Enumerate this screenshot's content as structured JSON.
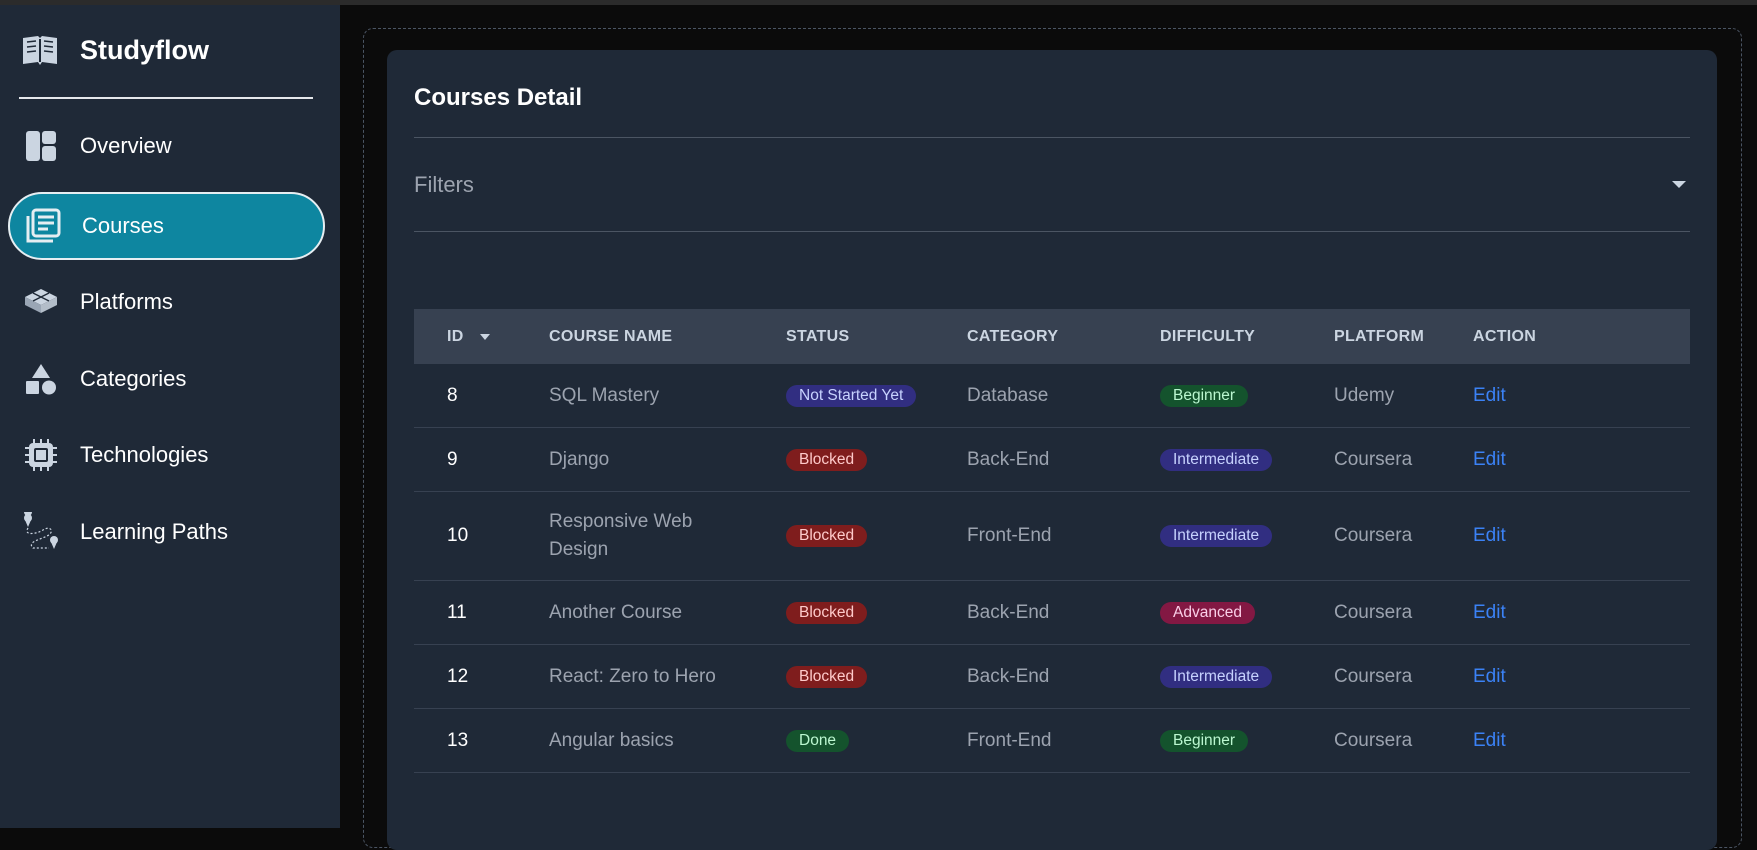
{
  "app": {
    "title": "Studyflow",
    "brand_icon": "book-open-icon"
  },
  "sidebar": {
    "items": [
      {
        "label": "Overview",
        "icon": "dashboard-icon",
        "active": false
      },
      {
        "label": "Courses",
        "icon": "courses-icon",
        "active": true
      },
      {
        "label": "Platforms",
        "icon": "platforms-icon",
        "active": false
      },
      {
        "label": "Categories",
        "icon": "categories-icon",
        "active": false
      },
      {
        "label": "Technologies",
        "icon": "chip-icon",
        "active": false
      },
      {
        "label": "Learning Paths",
        "icon": "route-icon",
        "active": false
      }
    ]
  },
  "main": {
    "title": "Courses Detail",
    "filters_label": "Filters"
  },
  "table": {
    "headers": [
      "ID",
      "COURSE NAME",
      "STATUS",
      "CATEGORY",
      "DIFFICULTY",
      "PLATFORM",
      "ACTION"
    ],
    "rows": [
      {
        "id": "8",
        "name": "SQL Mastery",
        "status": "Not Started Yet",
        "category": "Database",
        "difficulty": "Beginner",
        "platform": "Udemy",
        "action": "Edit"
      },
      {
        "id": "9",
        "name": "Django",
        "status": "Blocked",
        "category": "Back-End",
        "difficulty": "Intermediate",
        "platform": "Coursera",
        "action": "Edit"
      },
      {
        "id": "10",
        "name": "Responsive Web Design",
        "status": "Blocked",
        "category": "Front-End",
        "difficulty": "Intermediate",
        "platform": "Coursera",
        "action": "Edit"
      },
      {
        "id": "11",
        "name": "Another Course",
        "status": "Blocked",
        "category": "Back-End",
        "difficulty": "Advanced",
        "platform": "Coursera",
        "action": "Edit"
      },
      {
        "id": "12",
        "name": "React: Zero to Hero",
        "status": "Blocked",
        "category": "Back-End",
        "difficulty": "Intermediate",
        "platform": "Coursera",
        "action": "Edit"
      },
      {
        "id": "13",
        "name": "Angular basics",
        "status": "Done",
        "category": "Front-End",
        "difficulty": "Beginner",
        "platform": "Coursera",
        "action": "Edit"
      }
    ]
  },
  "colors": {
    "sidebar_bg": "#1f2937",
    "active_nav": "#0e86a0",
    "link": "#3b82f6"
  }
}
